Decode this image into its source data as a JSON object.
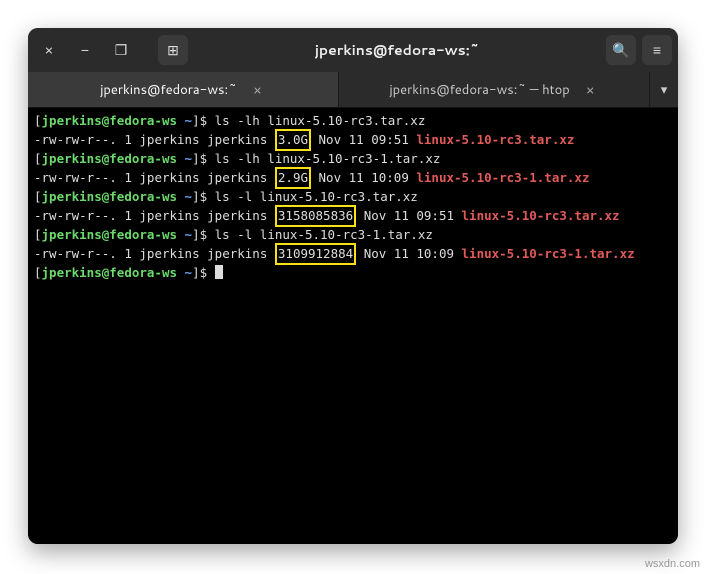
{
  "titlebar": {
    "close_label": "×",
    "minimize_label": "−",
    "maximize_label": "❐",
    "newtab_label": "⊞",
    "title": "jperkins@fedora-ws:~",
    "search_label": "🔍",
    "menu_label": "≡"
  },
  "tabs": [
    {
      "label": "jperkins@fedora-ws:~",
      "active": true
    },
    {
      "label": "jperkins@fedora-ws:~ — htop",
      "active": false
    }
  ],
  "tab_close_glyph": "×",
  "tab_dropdown_glyph": "▾",
  "prompt": {
    "user_host": "jperkins@fedora-ws",
    "cwd": "~",
    "sep_open": "[",
    "sep_close": "]$"
  },
  "lines": [
    {
      "type": "cmd",
      "text": "ls -lh linux-5.10-rc3.tar.xz"
    },
    {
      "type": "out",
      "perm": "-rw-rw-r--.",
      "links": "1",
      "owner": "jperkins",
      "group": "jperkins",
      "size": "3.0G",
      "date": "Nov 11 09:51",
      "file": "linux-5.10-rc3.tar.xz"
    },
    {
      "type": "cmd",
      "text": "ls -lh linux-5.10-rc3-1.tar.xz"
    },
    {
      "type": "out",
      "perm": "-rw-rw-r--.",
      "links": "1",
      "owner": "jperkins",
      "group": "jperkins",
      "size": "2.9G",
      "date": "Nov 11 10:09",
      "file": "linux-5.10-rc3-1.tar.xz"
    },
    {
      "type": "cmd",
      "text": "ls -l linux-5.10-rc3.tar.xz"
    },
    {
      "type": "out",
      "perm": "-rw-rw-r--.",
      "links": "1",
      "owner": "jperkins",
      "group": "jperkins",
      "size": "3158085836",
      "date": "Nov 11 09:51",
      "file": "linux-5.10-rc3.tar.xz"
    },
    {
      "type": "cmd",
      "text": "ls -l linux-5.10-rc3-1.tar.xz"
    },
    {
      "type": "out",
      "perm": "-rw-rw-r--.",
      "links": "1",
      "owner": "jperkins",
      "group": "jperkins",
      "size": "3109912884",
      "date": "Nov 11 10:09",
      "file": "linux-5.10-rc3-1.tar.xz"
    },
    {
      "type": "cmd",
      "text": "",
      "cursor": true
    }
  ],
  "watermark": "wsxdn.com"
}
